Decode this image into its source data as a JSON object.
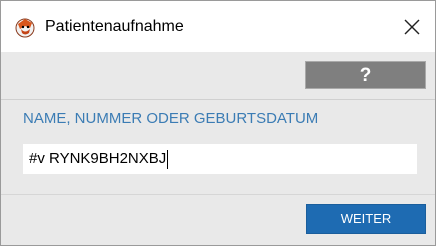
{
  "window": {
    "title": "Patientenaufnahme",
    "app_icon": "app-logo-icon",
    "close_icon": "close-icon"
  },
  "toolbar": {
    "help_label": "?"
  },
  "search": {
    "label": "NAME, NUMMER ODER GEBURTSDATUM",
    "value": "#v RYNK9BH2NXBJ"
  },
  "footer": {
    "continue_label": "WEITER"
  },
  "colors": {
    "accent": "#1e6bb2",
    "label": "#3b7cb4",
    "help_button": "#7f7f7f",
    "panel_background": "#e9e9e9"
  }
}
